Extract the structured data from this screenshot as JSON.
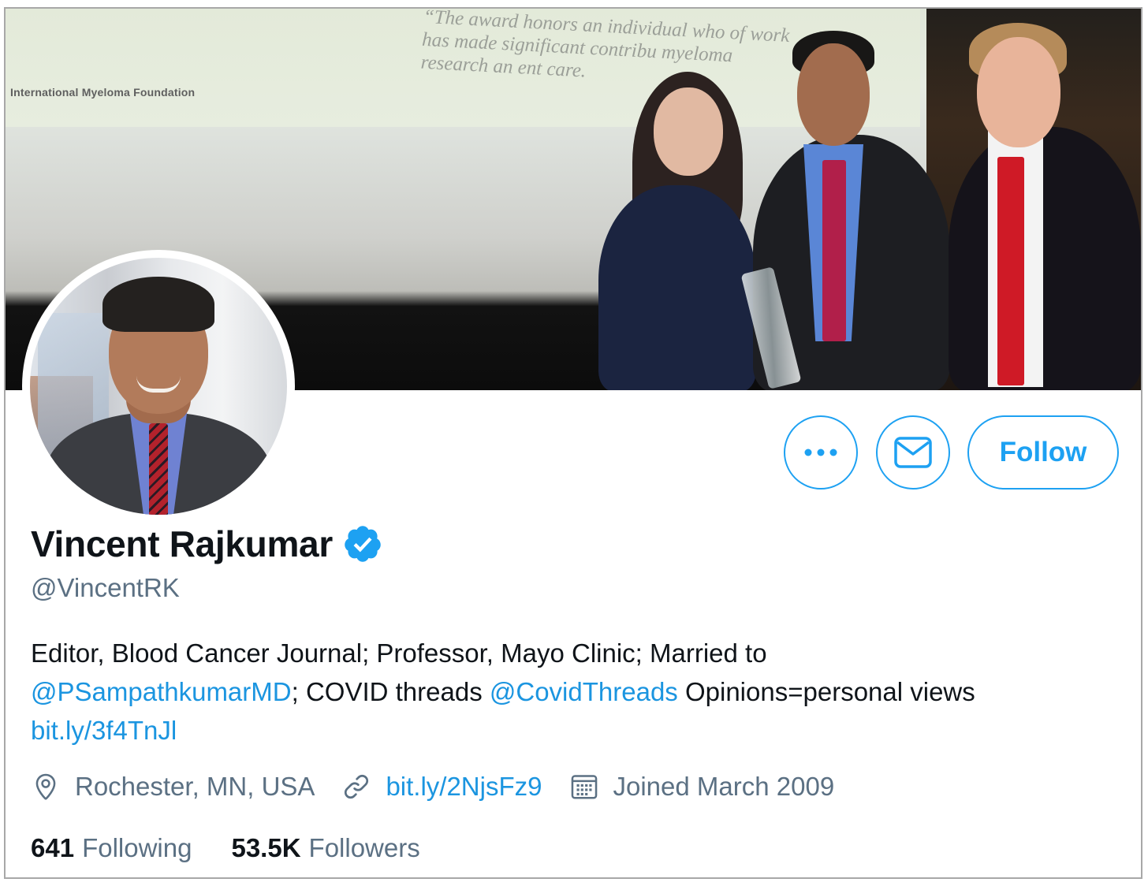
{
  "banner": {
    "slide_quote": "“The award honors an individual who of work has made significant contribu myeloma research an ent care.",
    "slide_org": "International Myeloma Foundation"
  },
  "profile": {
    "name": "Vincent Rajkumar",
    "handle": "@VincentRK",
    "verified": true,
    "bio": {
      "part1": "Editor, Blood Cancer Journal; Professor, Mayo Clinic; Married to",
      "mention1": "@PSampathkumarMD",
      "part2": "; COVID threads ",
      "mention2": "@CovidThreads",
      "part3": " Opinions=personal views",
      "link": "bit.ly/3f4TnJl"
    },
    "location": "Rochester, MN, USA",
    "website": "bit.ly/2NjsFz9",
    "joined": "Joined March 2009",
    "following_count": "641",
    "following_label": "Following",
    "followers_count": "53.5K",
    "followers_label": "Followers"
  },
  "actions": {
    "more_icon": "more-icon",
    "message_icon": "envelope-icon",
    "follow_label": "Follow"
  },
  "colors": {
    "accent": "#1da1f2",
    "link": "#1b95e0",
    "secondary_text": "#5b7083",
    "primary_text": "#0f1419"
  }
}
